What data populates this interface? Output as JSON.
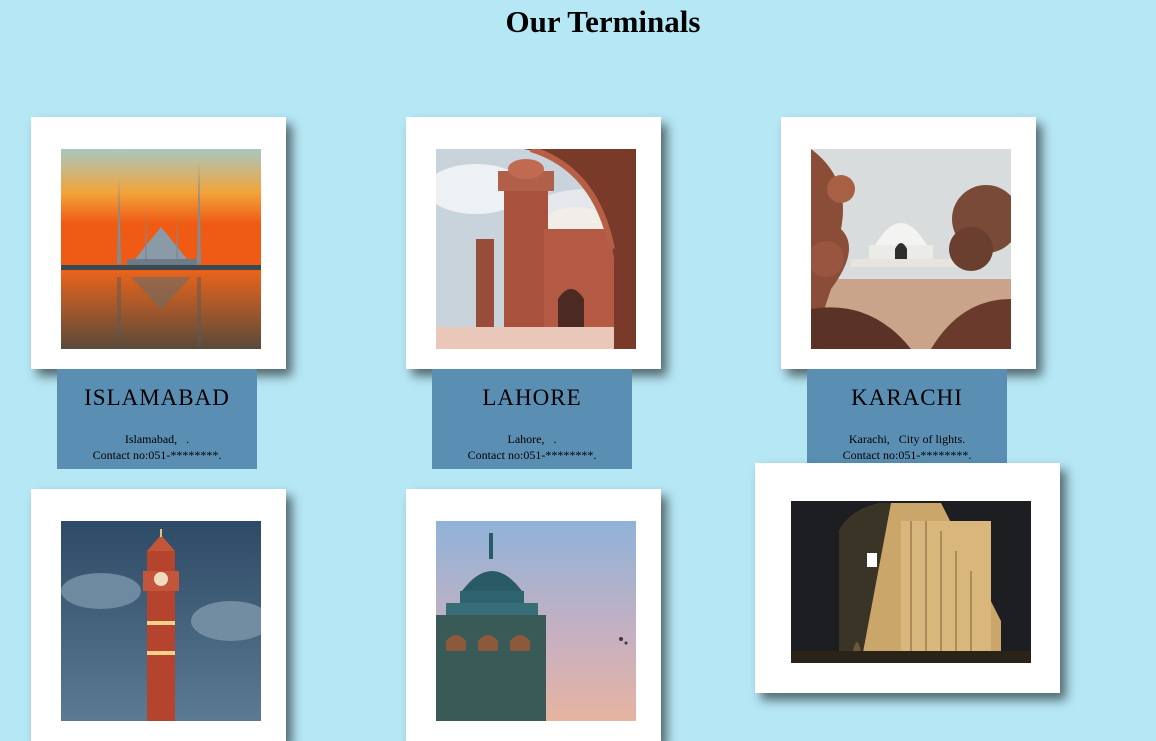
{
  "page": {
    "title": "Our Terminals"
  },
  "terminals": [
    {
      "city": "ISLAMABAD",
      "address": "Islamabad,   .",
      "contact": "Contact no:051-********."
    },
    {
      "city": "LAHORE",
      "address": "Lahore,   .",
      "contact": "Contact no:051-********."
    },
    {
      "city": "KARACHI",
      "address": "Karachi,   City of lights.",
      "contact": "Contact no:051-********."
    }
  ],
  "images": [
    {
      "icon": "faisal-mosque-photo"
    },
    {
      "icon": "badshahi-mosque-photo"
    },
    {
      "icon": "mazar-e-quaid-photo"
    },
    {
      "icon": "clock-tower-photo"
    },
    {
      "icon": "mosque-dome-photo"
    },
    {
      "icon": "hotel-tower-photo"
    }
  ]
}
